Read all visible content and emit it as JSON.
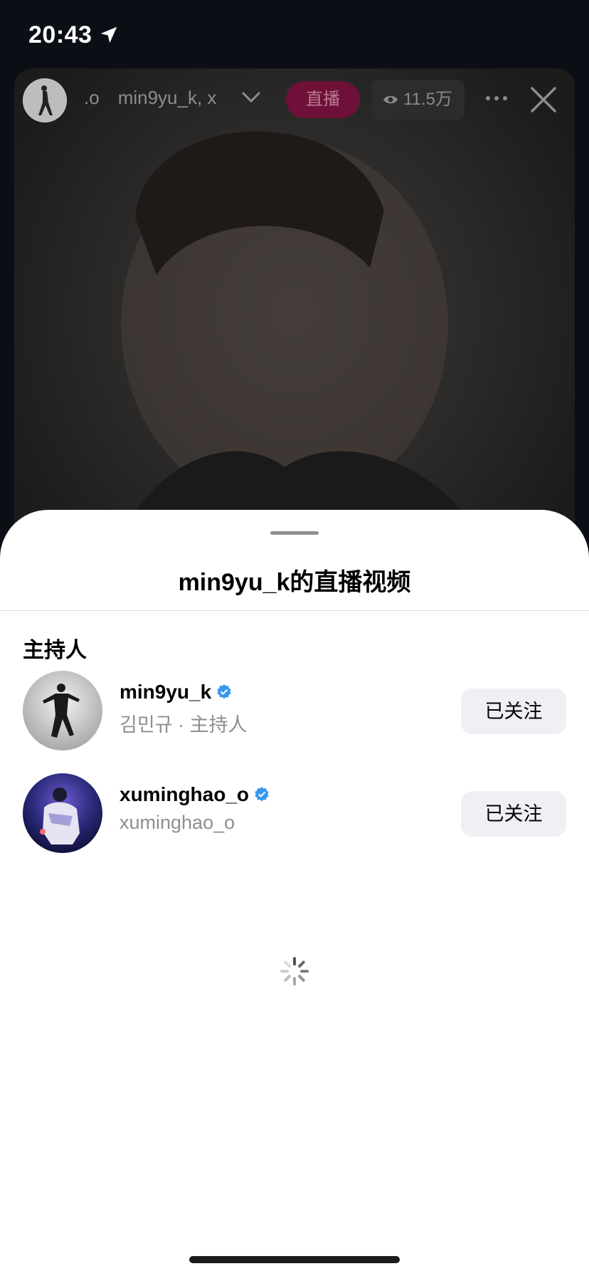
{
  "status_bar": {
    "time": "20:43"
  },
  "live": {
    "names_prefix": ".o",
    "names": "min9yu_k, x",
    "live_badge": "直播",
    "viewers": "11.5万"
  },
  "sheet": {
    "title": "min9yu_k的直播视频",
    "section_label": "主持人",
    "hosts": [
      {
        "username": "min9yu_k",
        "subtitle": "김민규 · 主持人",
        "follow_label": "已关注",
        "verified": true
      },
      {
        "username": "xuminghao_o",
        "subtitle": "xuminghao_o",
        "follow_label": "已关注",
        "verified": true
      }
    ]
  },
  "colors": {
    "live_badge_bg": "#6e1037",
    "verified_blue": "#3897f0",
    "follow_bg": "#efeff4"
  }
}
